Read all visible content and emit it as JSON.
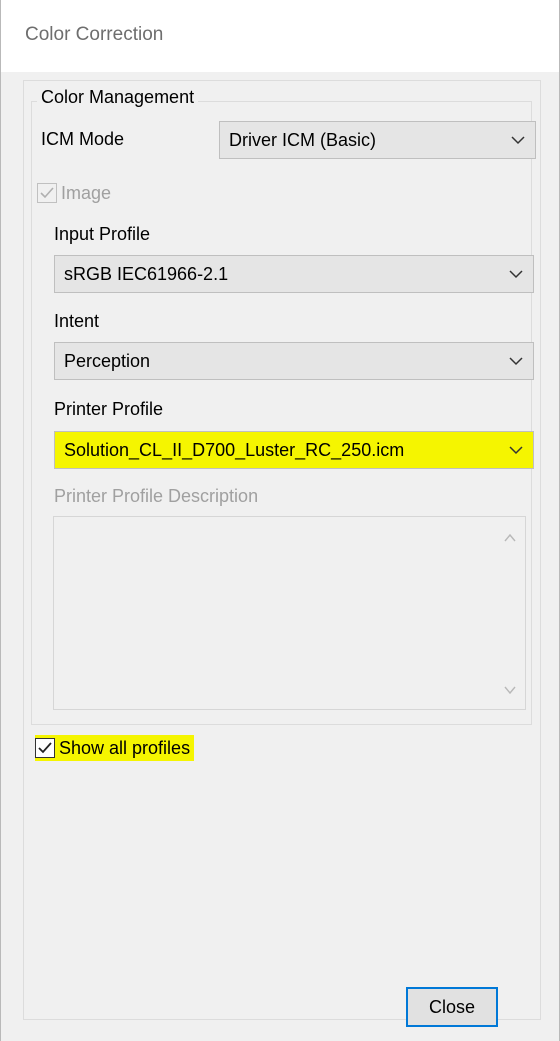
{
  "window": {
    "title": "Color Correction"
  },
  "color_management": {
    "legend": "Color Management",
    "icm_mode": {
      "label": "ICM Mode",
      "value": "Driver ICM (Basic)"
    },
    "image": {
      "label": "Image",
      "checked": true,
      "disabled": true
    },
    "input_profile": {
      "label": "Input Profile",
      "value": "sRGB IEC61966-2.1"
    },
    "intent": {
      "label": "Intent",
      "value": "Perception"
    },
    "printer_profile": {
      "label": "Printer Profile",
      "value": "Solution_CL_II_D700_Luster_RC_250.icm"
    },
    "printer_profile_description": {
      "label": "Printer Profile Description",
      "value": ""
    }
  },
  "show_all_profiles": {
    "label": "Show all profiles",
    "checked": true
  },
  "footer": {
    "close_label": "Close"
  },
  "colors": {
    "highlight": "#f5f500",
    "focus_border": "#0078d7",
    "disabled_text": "#a0a0a0"
  }
}
